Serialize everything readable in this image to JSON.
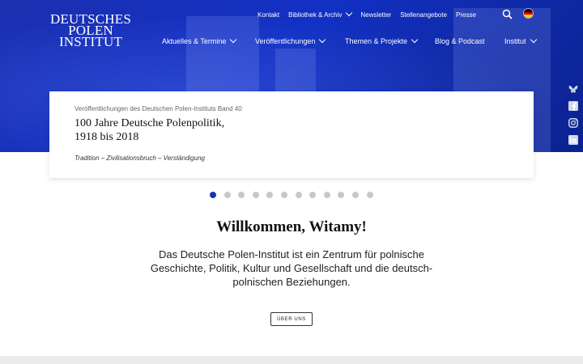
{
  "logo": {
    "line1": "DEUTSCHES",
    "line2": "POLEN",
    "line3": "INSTITUT"
  },
  "top_nav": [
    {
      "label": "Kontakt"
    },
    {
      "label": "Bibliothek & Archiv"
    },
    {
      "label": "Newsletter"
    },
    {
      "label": "Stellenangebote"
    },
    {
      "label": "Presse"
    }
  ],
  "main_nav": [
    {
      "label": "Aktuelles & Termine"
    },
    {
      "label": "Veröffentlichungen"
    },
    {
      "label": "Themen & Projekte"
    },
    {
      "label": "Blog & Podcast"
    },
    {
      "label": "Institut"
    }
  ],
  "icons": {
    "search": "search-icon",
    "language": "german-flag-icon",
    "social": [
      "bluesky-icon",
      "facebook-icon",
      "instagram-icon",
      "linkedin-icon"
    ]
  },
  "colors": {
    "hero_blue": "#1230c4",
    "active_dot": "#1a34b8",
    "inactive_dot": "#c8c8c8"
  },
  "slide": {
    "series": "Veröffentlichungen des Deutschen Polen-Instituts Band 40",
    "title_line1": "100 Jahre Deutsche Polenpolitik,",
    "title_line2": "1918 bis 2018",
    "subtitle": "Tradition – Zivilisationsbruch – Verständigung"
  },
  "carousel": {
    "total": 12,
    "active_index": 0
  },
  "welcome": {
    "heading": "Willkommen, Witamy!",
    "text": "Das Deutsche Polen-Institut ist ein Zentrum für polnische Geschichte, Politik, Kultur und Gesellschaft und die deutsch-polnischen Beziehungen.",
    "button": "ÜBER UNS"
  }
}
